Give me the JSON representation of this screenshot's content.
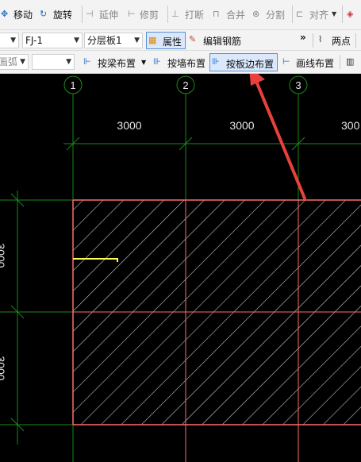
{
  "toolbar_row1": {
    "move": "移动",
    "rotate": "旋转",
    "extend": "延伸",
    "trim": "修剪",
    "break": "打断",
    "merge": "合并",
    "split": "分割",
    "align": "对齐"
  },
  "toolbar_row2": {
    "component": "FJ-1",
    "layer": "分层板1",
    "properties": "属性",
    "edit_rebar": "编辑钢筋",
    "more": "»",
    "two_point": "两点"
  },
  "toolbar_row3": {
    "arc_mode": "画弧",
    "beam_layout": "按梁布置",
    "wall_layout": "按墙布置",
    "slab_edge_layout": "按板边布置",
    "line_layout": "画线布置"
  },
  "canvas": {
    "axis_labels": [
      "1",
      "2",
      "3"
    ],
    "dimensions": [
      "3000",
      "3000",
      "300"
    ],
    "left_dims": [
      "3000",
      "3000"
    ],
    "colors": {
      "grid": "#1a8a1a",
      "slab_border": "#ff6b6b",
      "hatch": "#d8d8d8",
      "pointer_arrow": "#e8413c",
      "marker": "#ffff55"
    }
  }
}
